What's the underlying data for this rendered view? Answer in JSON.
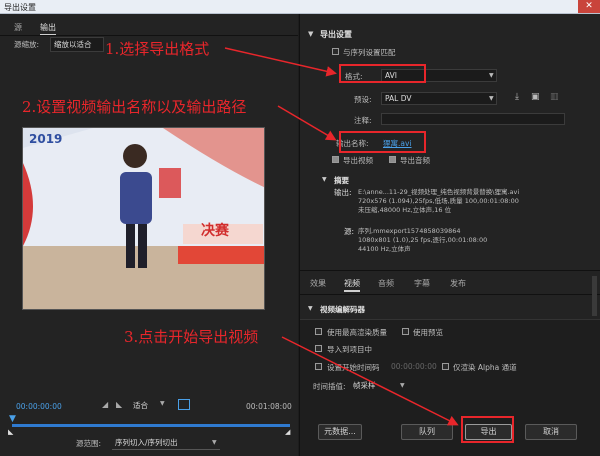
{
  "window": {
    "title": "导出设置",
    "close": "✕"
  },
  "left": {
    "tabs": [
      {
        "label": "源"
      },
      {
        "label": "输出"
      }
    ],
    "scaling_label": "源缩放:",
    "scaling_value": "缩放以适合",
    "preview_logo": "2019",
    "preview_banner": "决赛",
    "timecode_start": "00:00:00:00",
    "timecode_end": "00:01:08:00",
    "fit_value": "适合",
    "range_label": "源范围:",
    "range_value": "序列切入/序列切出"
  },
  "annotations": {
    "step1": "1.选择导出格式",
    "step2": "2.设置视频输出名称以及输出路径",
    "step3": "3.点击开始导出视频"
  },
  "export": {
    "section_title": "导出设置",
    "match_sequence": "与序列设置匹配",
    "format_label": "格式:",
    "format_value": "AVI",
    "preset_label": "预设:",
    "preset_value": "PAL DV",
    "comment_label": "注释:",
    "output_name_label": "输出名称:",
    "output_name_value": "狸寓.avi",
    "export_video": "导出视频",
    "export_audio": "导出音频"
  },
  "summary": {
    "title": "摘要",
    "output_label": "输出:",
    "output_lines": [
      "E:\\anne...11-29_视频处理_纯色视频背景替换\\狸寓.avi",
      "720x576 (1.094),25fps,低场,质量 100,00:01:08:00",
      "未压缩,48000 Hz,立体声,16 位"
    ],
    "source_label": "源:",
    "source_lines": [
      "序列,mmexport1574858039864",
      "1080x801 (1.0),25 fps,逐行,00:01:08:00",
      "44100 Hz,立体声"
    ]
  },
  "settings_tabs": [
    {
      "label": "效果"
    },
    {
      "label": "视频"
    },
    {
      "label": "音频"
    },
    {
      "label": "字幕"
    },
    {
      "label": "发布"
    }
  ],
  "codec_section": "视频编解码器",
  "options": {
    "max_render": "使用最高渲染质量",
    "use_preview": "使用预览",
    "import_project": "导入到项目中",
    "set_start_tc": "设置开始时间码",
    "start_tc_value": "00:00:00:00",
    "alpha_only": "仅渲染 Alpha 通道",
    "interp_label": "时间插值:",
    "interp_value": "帧采样"
  },
  "buttons": {
    "metadata": "元数据...",
    "queue": "队列",
    "export": "导出",
    "cancel": "取消"
  }
}
